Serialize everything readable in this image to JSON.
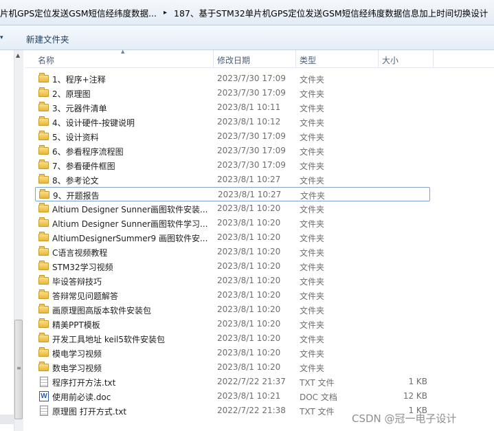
{
  "address_bar": {
    "crumb1": "片机GPS定位发送GSM短信经纬度数据...",
    "crumb2": "187、基于STM32单片机GPS定位发送GSM短信经纬度数据信息加上时间切换设计",
    "separator": "▸"
  },
  "toolbar": {
    "new_folder_label": "新建文件夹",
    "organize_arrow": "▾"
  },
  "columns": {
    "name": "名称",
    "date": "修改日期",
    "type": "类型",
    "size": "大小"
  },
  "rows": [
    {
      "name": "1、程序+注释",
      "date": "2023/7/30 17:09",
      "type": "文件夹",
      "size": "",
      "icon": "folder-icon"
    },
    {
      "name": "2、原理图",
      "date": "2023/7/30 17:09",
      "type": "文件夹",
      "size": "",
      "icon": "folder-icon"
    },
    {
      "name": "3、元器件清单",
      "date": "2023/8/1 10:11",
      "type": "文件夹",
      "size": "",
      "icon": "folder-icon"
    },
    {
      "name": "4、设计硬件-按键说明",
      "date": "2023/8/1 10:12",
      "type": "文件夹",
      "size": "",
      "icon": "folder-icon"
    },
    {
      "name": "5、设计资料",
      "date": "2023/7/30 17:09",
      "type": "文件夹",
      "size": "",
      "icon": "folder-icon"
    },
    {
      "name": "6、参看程序流程图",
      "date": "2023/7/30 17:09",
      "type": "文件夹",
      "size": "",
      "icon": "folder-icon"
    },
    {
      "name": "7、参看硬件框图",
      "date": "2023/7/30 17:09",
      "type": "文件夹",
      "size": "",
      "icon": "folder-icon"
    },
    {
      "name": "8、参考论文",
      "date": "2023/8/1 10:27",
      "type": "文件夹",
      "size": "",
      "icon": "folder-icon"
    },
    {
      "name": "9、开题报告",
      "date": "2023/8/1 10:27",
      "type": "文件夹",
      "size": "",
      "icon": "folder-icon",
      "selected": true
    },
    {
      "name": "Altium Designer Sunner画图软件安装...",
      "date": "2023/8/1 10:20",
      "type": "文件夹",
      "size": "",
      "icon": "folder-icon"
    },
    {
      "name": "Altium Designer Sunner画图软件学习...",
      "date": "2023/8/1 10:20",
      "type": "文件夹",
      "size": "",
      "icon": "folder-icon"
    },
    {
      "name": "AltiumDesignerSummer9 画图软件安...",
      "date": "2023/8/1 10:20",
      "type": "文件夹",
      "size": "",
      "icon": "folder-icon"
    },
    {
      "name": "C语言视频教程",
      "date": "2023/8/1 10:20",
      "type": "文件夹",
      "size": "",
      "icon": "folder-icon"
    },
    {
      "name": "STM32学习视频",
      "date": "2023/8/1 10:20",
      "type": "文件夹",
      "size": "",
      "icon": "folder-icon"
    },
    {
      "name": "毕设答辩技巧",
      "date": "2023/8/1 10:20",
      "type": "文件夹",
      "size": "",
      "icon": "folder-icon"
    },
    {
      "name": "答辩常见问题解答",
      "date": "2023/8/1 10:20",
      "type": "文件夹",
      "size": "",
      "icon": "folder-icon"
    },
    {
      "name": "画原理图高版本软件安装包",
      "date": "2023/8/1 10:20",
      "type": "文件夹",
      "size": "",
      "icon": "folder-icon"
    },
    {
      "name": "精美PPT模板",
      "date": "2023/8/1 10:20",
      "type": "文件夹",
      "size": "",
      "icon": "folder-icon"
    },
    {
      "name": "开发工具地址 keil5软件安装包",
      "date": "2023/8/1 10:20",
      "type": "文件夹",
      "size": "",
      "icon": "folder-icon"
    },
    {
      "name": "模电学习视频",
      "date": "2023/8/1 10:20",
      "type": "文件夹",
      "size": "",
      "icon": "folder-icon"
    },
    {
      "name": "数电学习视频",
      "date": "2023/8/1 10:20",
      "type": "文件夹",
      "size": "",
      "icon": "folder-icon"
    },
    {
      "name": "程序打开方法.txt",
      "date": "2022/7/22 21:37",
      "type": "TXT 文件",
      "size": "1 KB",
      "icon": "text-file-icon"
    },
    {
      "name": "使用前必读.doc",
      "date": "2023/8/1 10:21",
      "type": "DOC 文档",
      "size": "12 KB",
      "icon": "word-doc-icon",
      "icon_glyph": "W"
    },
    {
      "name": "原理图 打开方式.txt",
      "date": "2022/7/22 21:38",
      "type": "TXT 文件",
      "size": "1 KB",
      "icon": "text-file-icon"
    }
  ],
  "watermark": "CSDN @冠一电子设计",
  "colors": {
    "selection_border": "#7da2ce",
    "header_text": "#4c607a",
    "folder": "#e9b73a"
  }
}
